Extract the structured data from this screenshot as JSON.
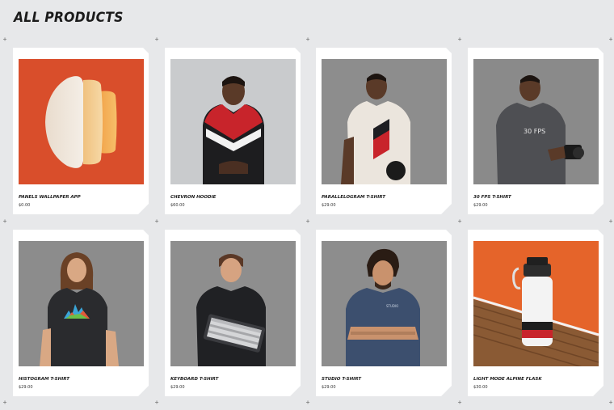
{
  "page": {
    "title": "ALL PRODUCTS"
  },
  "products": [
    {
      "name": "PANELS WALLPAPER APP",
      "price": "$0.00",
      "image": "panels-wallpaper-graphic"
    },
    {
      "name": "CHEVRON HOODIE",
      "price": "$60.00",
      "image": "chevron-hoodie-photo"
    },
    {
      "name": "PARALLELOGRAM T-SHIRT",
      "price": "$29.00",
      "image": "parallelogram-tshirt-photo"
    },
    {
      "name": "30 FPS T-SHIRT",
      "price": "$29.00",
      "image": "30fps-tshirt-photo"
    },
    {
      "name": "HISTOGRAM T-SHIRT",
      "price": "$29.00",
      "image": "histogram-tshirt-photo"
    },
    {
      "name": "KEYBOARD T-SHIRT",
      "price": "$29.00",
      "image": "keyboard-tshirt-photo"
    },
    {
      "name": "STUDIO T-SHIRT",
      "price": "$29.00",
      "image": "studio-tshirt-photo"
    },
    {
      "name": "LIGHT MODE ALPINE FLASK",
      "price": "$30.00",
      "image": "alpine-flask-photo"
    }
  ],
  "colors": {
    "background": "#e7e8ea",
    "card": "#ffffff",
    "panels_orange": "#d94e2b",
    "photo_gray": "#8e8e8e",
    "flask_wall": "#e5642a"
  }
}
